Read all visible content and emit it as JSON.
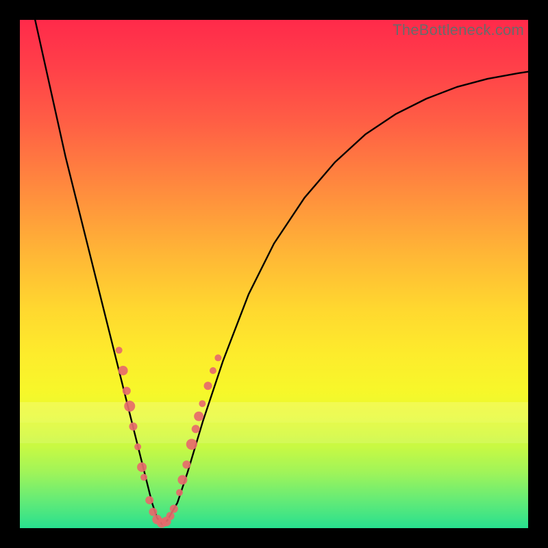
{
  "watermark": "TheBottleneck.com",
  "colors": {
    "background": "#000000",
    "curve": "#000000",
    "dots": "#e66a6b"
  },
  "chart_data": {
    "type": "line",
    "title": "",
    "xlabel": "",
    "ylabel": "",
    "xlim": [
      0,
      100
    ],
    "ylim": [
      0,
      100
    ],
    "series": [
      {
        "name": "bottleneck-curve",
        "x": [
          3,
          5,
          7,
          9,
          11,
          13,
          15,
          17,
          19,
          20.5,
          22,
          23.5,
          25,
          26,
          27,
          28,
          29,
          31,
          33,
          36,
          40,
          45,
          50,
          56,
          62,
          68,
          74,
          80,
          86,
          92,
          98,
          100
        ],
        "y": [
          100,
          91,
          82,
          73,
          65,
          57,
          49,
          41,
          33,
          27,
          21,
          15,
          9,
          5,
          2,
          0.8,
          1.5,
          5,
          11,
          21,
          33,
          46,
          56,
          65,
          72,
          77.5,
          81.5,
          84.5,
          86.8,
          88.4,
          89.5,
          89.8
        ]
      }
    ],
    "scatter": [
      {
        "name": "cluster-left",
        "points": [
          {
            "x": 19.5,
            "y": 35,
            "r": 5
          },
          {
            "x": 20.3,
            "y": 31,
            "r": 7
          },
          {
            "x": 21.0,
            "y": 27,
            "r": 6
          },
          {
            "x": 21.6,
            "y": 24,
            "r": 8
          },
          {
            "x": 22.3,
            "y": 20,
            "r": 6
          },
          {
            "x": 23.2,
            "y": 16,
            "r": 5
          },
          {
            "x": 24.0,
            "y": 12,
            "r": 7
          },
          {
            "x": 24.4,
            "y": 10,
            "r": 5
          }
        ]
      },
      {
        "name": "cluster-bottom",
        "points": [
          {
            "x": 25.5,
            "y": 5.5,
            "r": 6
          },
          {
            "x": 26.2,
            "y": 3.2,
            "r": 6
          },
          {
            "x": 27.0,
            "y": 1.7,
            "r": 7
          },
          {
            "x": 27.9,
            "y": 1.0,
            "r": 7
          },
          {
            "x": 28.8,
            "y": 1.3,
            "r": 7
          },
          {
            "x": 29.6,
            "y": 2.4,
            "r": 6
          },
          {
            "x": 30.3,
            "y": 3.8,
            "r": 6
          }
        ]
      },
      {
        "name": "cluster-right",
        "points": [
          {
            "x": 31.4,
            "y": 7.0,
            "r": 5
          },
          {
            "x": 32.0,
            "y": 9.5,
            "r": 7
          },
          {
            "x": 32.8,
            "y": 12.5,
            "r": 6
          },
          {
            "x": 33.8,
            "y": 16.5,
            "r": 8
          },
          {
            "x": 34.6,
            "y": 19.5,
            "r": 6
          },
          {
            "x": 35.2,
            "y": 22.0,
            "r": 7
          },
          {
            "x": 35.9,
            "y": 24.5,
            "r": 5
          },
          {
            "x": 37.0,
            "y": 28.0,
            "r": 6
          },
          {
            "x": 38.0,
            "y": 31.0,
            "r": 5
          },
          {
            "x": 39.0,
            "y": 33.5,
            "r": 5
          }
        ]
      }
    ]
  }
}
